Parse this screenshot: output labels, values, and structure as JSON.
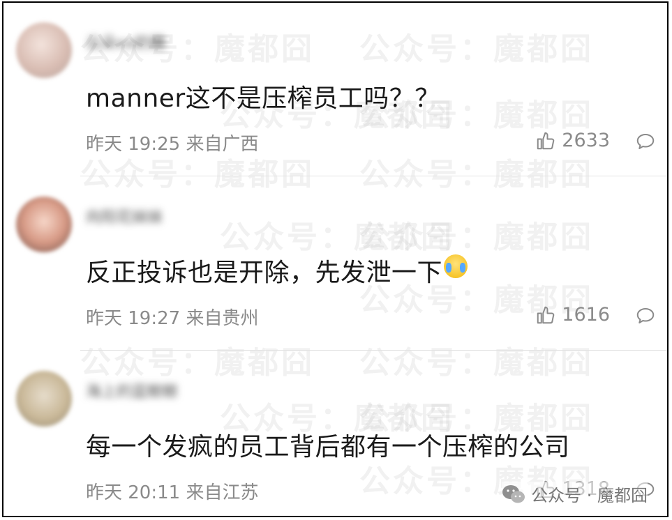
{
  "comments": [
    {
      "username": "云朵xx奶糖",
      "text": "manner这不是压榨员工吗？？",
      "meta": "昨天 19:25 来自广西",
      "likes": "2633"
    },
    {
      "username": "向阳花妹妹",
      "text": "反正投诉也是开除，先发泄一下",
      "meta": "昨天 19:27 来自贵州",
      "likes": "1616",
      "emoji": "crying-laughing-emoji"
    },
    {
      "username": "海上的蓝鲸鲸",
      "text": "每一个发疯的员工背后都有一个压榨的公司",
      "meta": "昨天 20:11 来自江苏",
      "likes": "1318"
    }
  ],
  "watermark": {
    "text": "公众号：魔都囧"
  },
  "brand": {
    "icon": "wechat-icon",
    "label": "公众号 · 魔都囧"
  },
  "colors": {
    "text": "#1a1a1a",
    "meta": "#8a8a8a",
    "divider": "#e2e2e2",
    "border": "#000000"
  }
}
